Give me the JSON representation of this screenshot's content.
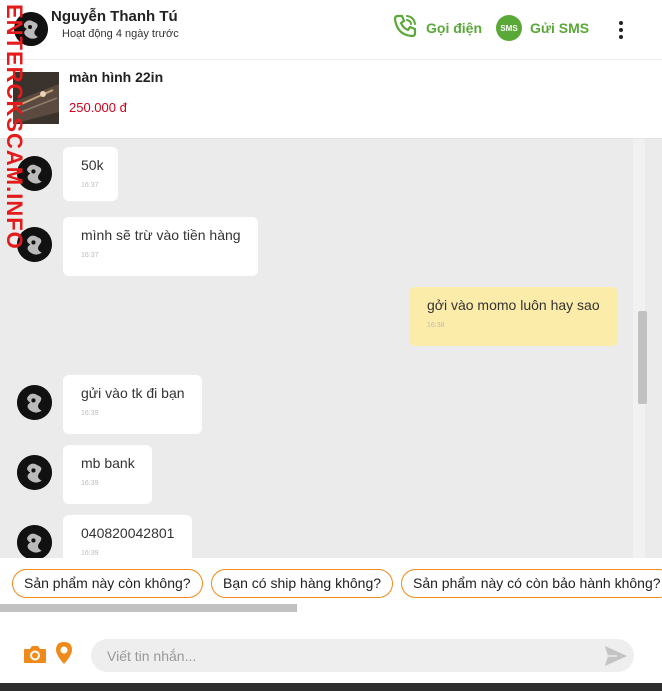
{
  "header": {
    "contact_name": "Nguyễn Thanh Tú",
    "status": "Hoạt động 4 ngày trước",
    "call_label": "Gọi điện",
    "sms_badge": "SMS",
    "sms_label": "Gửi SMS"
  },
  "watermark": "ENTERCKSCAM.INFO",
  "product": {
    "title": "màn hình 22in",
    "price": "250.000 đ"
  },
  "messages": [
    {
      "sender": "contact",
      "text": "50k",
      "time": "16:37"
    },
    {
      "sender": "contact",
      "text": "mình sẽ trừ vào tiền hàng",
      "time": "16:37"
    },
    {
      "sender": "me",
      "text": "gởi vào momo luôn hay sao",
      "time": "16:38"
    },
    {
      "sender": "contact",
      "text": "gửi vào tk đi bạn",
      "time": "16:39"
    },
    {
      "sender": "contact",
      "text": "mb bank",
      "time": "16:39"
    },
    {
      "sender": "contact",
      "text": "040820042801",
      "time": "16:39"
    }
  ],
  "quick_replies": [
    "Sản phẩm này còn không?",
    "Bạn có ship hàng không?",
    "Sản phẩm này có còn bảo hành không?"
  ],
  "composer": {
    "placeholder": "Viết tin nhắn..."
  },
  "colors": {
    "accent_green": "#5aa837",
    "chip_border": "#f08a1a",
    "price_red": "#d0021b",
    "my_bubble": "#fcecaa",
    "watermark_red": "#e31b1b"
  }
}
